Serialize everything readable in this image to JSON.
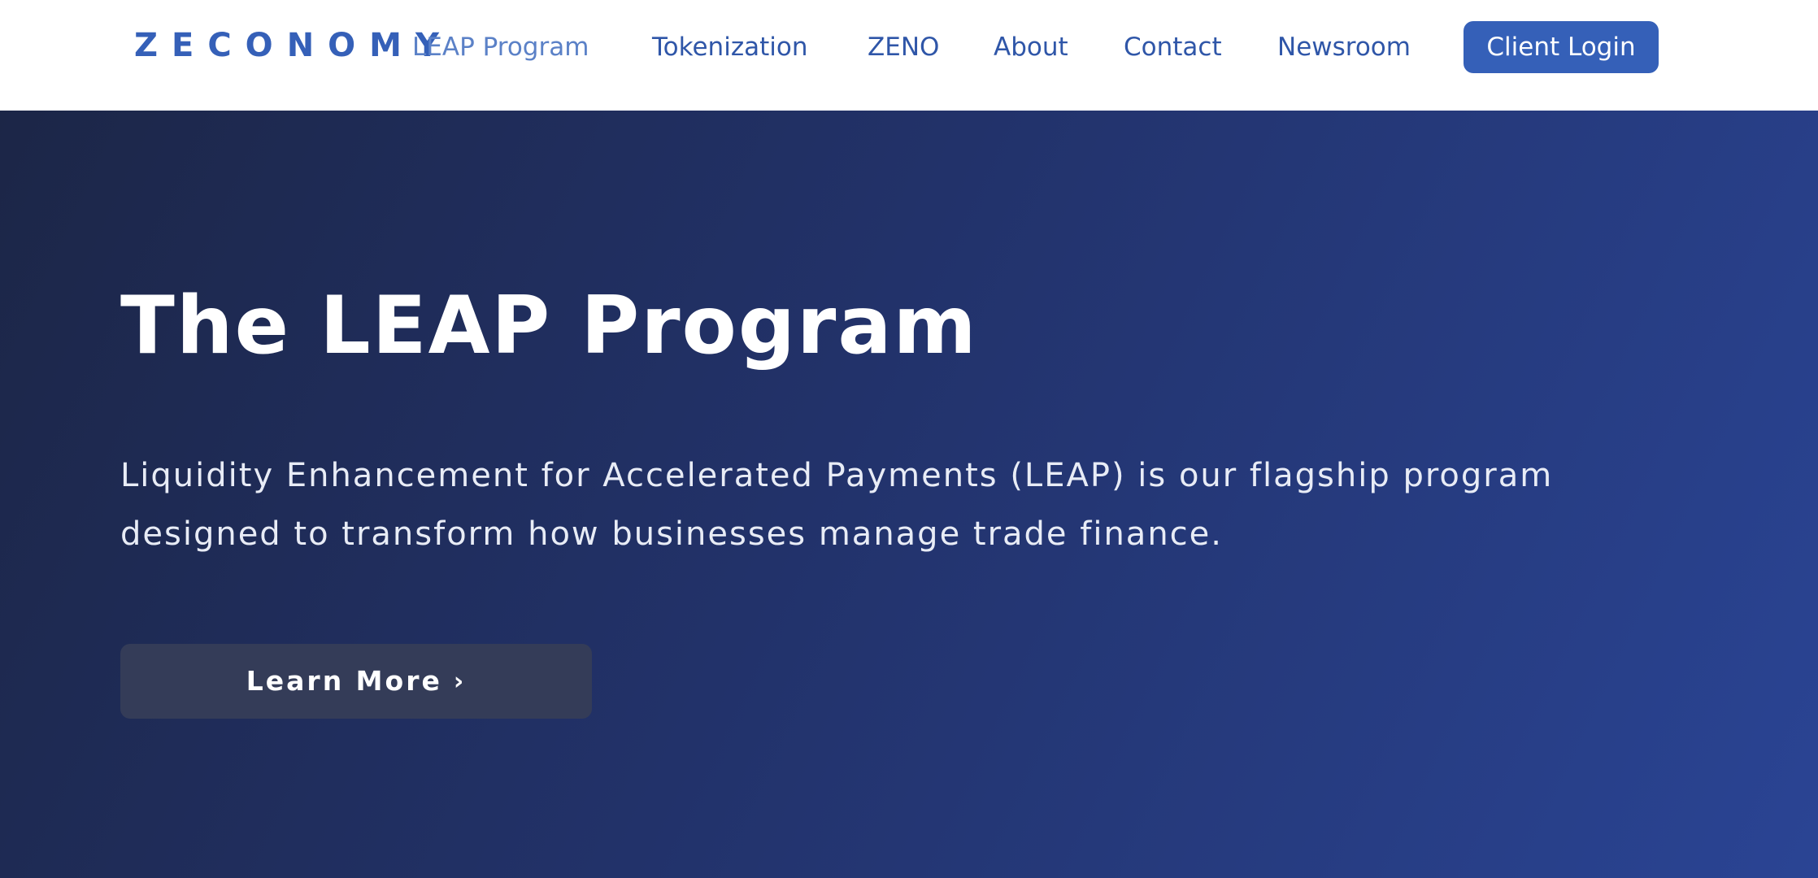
{
  "header": {
    "logo": "ZECONOMY",
    "nav": [
      {
        "label": "LEAP Program"
      },
      {
        "label": "Tokenization"
      },
      {
        "label": "ZENO"
      },
      {
        "label": "About"
      },
      {
        "label": "Contact"
      },
      {
        "label": "Newsroom"
      }
    ],
    "login_label": "Client Login"
  },
  "hero": {
    "title": "The LEAP Program",
    "description": "Liquidity Enhancement for Accelerated Payments (LEAP) is our flagship program designed to transform how businesses manage trade finance.",
    "cta_label": "Learn More",
    "cta_icon": "chevron-right-icon"
  },
  "colors": {
    "brand_blue": "#3560b8",
    "nav_text": "#2f56a8",
    "hero_gradient_start": "#1c2647",
    "hero_gradient_end": "#2a4494",
    "cta_background": "#343c58"
  }
}
